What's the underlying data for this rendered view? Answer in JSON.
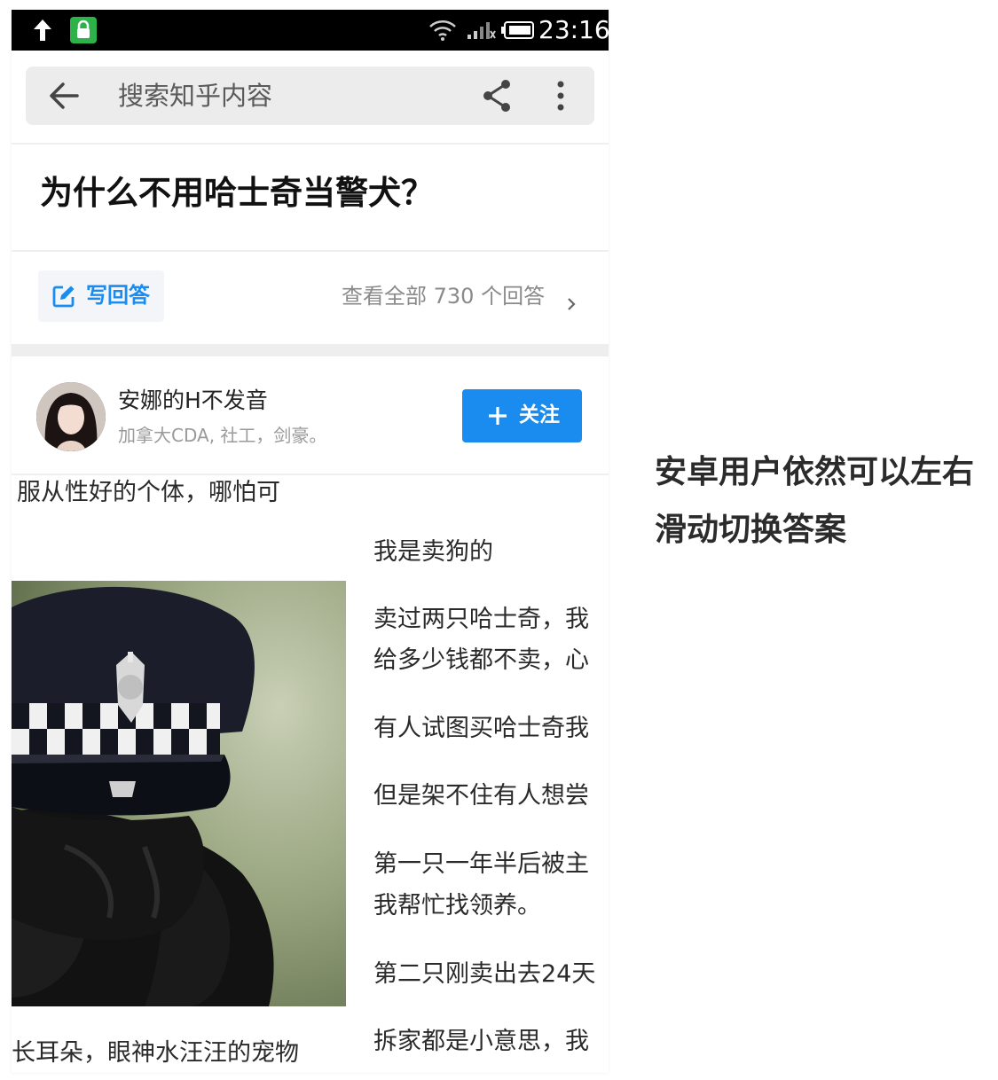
{
  "status_bar": {
    "time": "23:16"
  },
  "search": {
    "placeholder": "搜索知乎内容"
  },
  "question": {
    "title": "为什么不用哈士奇当警犬？"
  },
  "actions": {
    "write_answer": "写回答",
    "view_all": "查看全部 730 个回答"
  },
  "author": {
    "name": "安娜的H不发音",
    "bio": "加拿大CDA, 社工，剑豪。",
    "follow_label": "关注"
  },
  "answer": {
    "left_line_top": "服从性好的个体，哪怕可",
    "left_line_bottom": "长耳朵，眼神水汪汪的宠物",
    "right_lines": [
      "我是卖狗的",
      "卖过两只哈士奇，我",
      "给多少钱都不卖，心",
      "有人试图买哈士奇我",
      "但是架不住有人想尝",
      "第一只一年半后被主",
      "我帮忙找领养。",
      "第二只刚卖出去24天",
      "拆家都是小意思，我"
    ]
  },
  "caption": {
    "line1": "安卓用户依然可以左右",
    "line2": "滑动切换答案"
  },
  "colors": {
    "accent": "#1a8cf0",
    "status_bar": "#000000",
    "search_bg": "#ececec"
  }
}
